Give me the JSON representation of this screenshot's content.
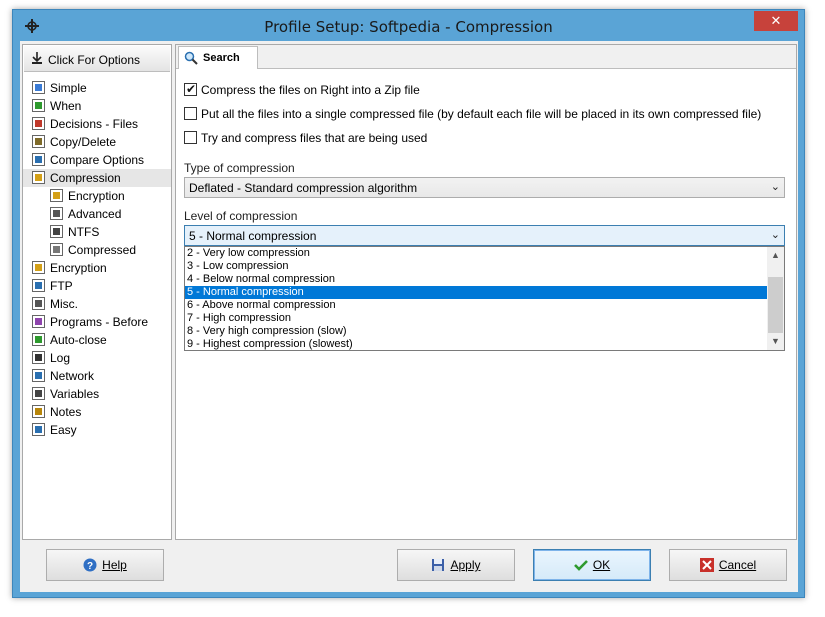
{
  "window": {
    "title": "Profile Setup: Softpedia - Compression",
    "close_label": "✕"
  },
  "sidebar": {
    "options_button": "Click For Options",
    "items": [
      {
        "label": "Simple",
        "icon": "checklist-icon",
        "indent": 0,
        "selected": false
      },
      {
        "label": "When",
        "icon": "clock-icon",
        "indent": 0,
        "selected": false
      },
      {
        "label": "Decisions - Files",
        "icon": "decisions-icon",
        "indent": 0,
        "selected": false
      },
      {
        "label": "Copy/Delete",
        "icon": "copy-delete-icon",
        "indent": 0,
        "selected": false
      },
      {
        "label": "Compare Options",
        "icon": "compare-icon",
        "indent": 0,
        "selected": false
      },
      {
        "label": "Compression",
        "icon": "compression-icon",
        "indent": 0,
        "selected": true
      },
      {
        "label": "Encryption",
        "icon": "lock-icon",
        "indent": 1,
        "selected": false
      },
      {
        "label": "Advanced",
        "icon": "advanced-icon",
        "indent": 1,
        "selected": false
      },
      {
        "label": "NTFS",
        "icon": "ntfs-icon",
        "indent": 1,
        "selected": false
      },
      {
        "label": "Compressed",
        "icon": "compressed-icon",
        "indent": 1,
        "selected": false
      },
      {
        "label": "Encryption",
        "icon": "lock-icon",
        "indent": 0,
        "selected": false
      },
      {
        "label": "FTP",
        "icon": "ftp-icon",
        "indent": 0,
        "selected": false
      },
      {
        "label": "Misc.",
        "icon": "misc-icon",
        "indent": 0,
        "selected": false
      },
      {
        "label": "Programs - Before",
        "icon": "programs-icon",
        "indent": 0,
        "selected": false
      },
      {
        "label": "Auto-close",
        "icon": "auto-close-icon",
        "indent": 0,
        "selected": false
      },
      {
        "label": "Log",
        "icon": "log-icon",
        "indent": 0,
        "selected": false
      },
      {
        "label": "Network",
        "icon": "network-icon",
        "indent": 0,
        "selected": false
      },
      {
        "label": "Variables",
        "icon": "variables-icon",
        "indent": 0,
        "selected": false
      },
      {
        "label": "Notes",
        "icon": "notes-icon",
        "indent": 0,
        "selected": false
      },
      {
        "label": "Easy",
        "icon": "easy-icon",
        "indent": 0,
        "selected": false
      }
    ]
  },
  "tabs": {
    "search_label": "Search"
  },
  "compression": {
    "checkboxes": [
      {
        "label": "Compress the files on Right into a Zip file",
        "checked": true
      },
      {
        "label": "Put all the files into a single compressed file (by default each file will be placed in its own compressed file)",
        "checked": false
      },
      {
        "label": "Try and compress files that are being used",
        "checked": false
      }
    ],
    "type_label": "Type of compression",
    "type_value": "Deflated - Standard compression algorithm",
    "level_label": "Level of compression",
    "level_value": "5 - Normal compression",
    "level_options": [
      "2 - Very low compression",
      "3 - Low compression",
      "4 - Below normal compression",
      "5 - Normal compression",
      "6 - Above normal compression",
      "7 - High compression",
      "8 - Very high compression (slow)",
      "9 - Highest compression (slowest)"
    ],
    "level_selected_index": 3
  },
  "buttons": {
    "help": "Help",
    "apply": "Apply",
    "ok": "OK",
    "cancel": "Cancel"
  },
  "colors": {
    "titlebar": "#5aa4d6",
    "close": "#c7423b",
    "selection": "#0078d7"
  }
}
